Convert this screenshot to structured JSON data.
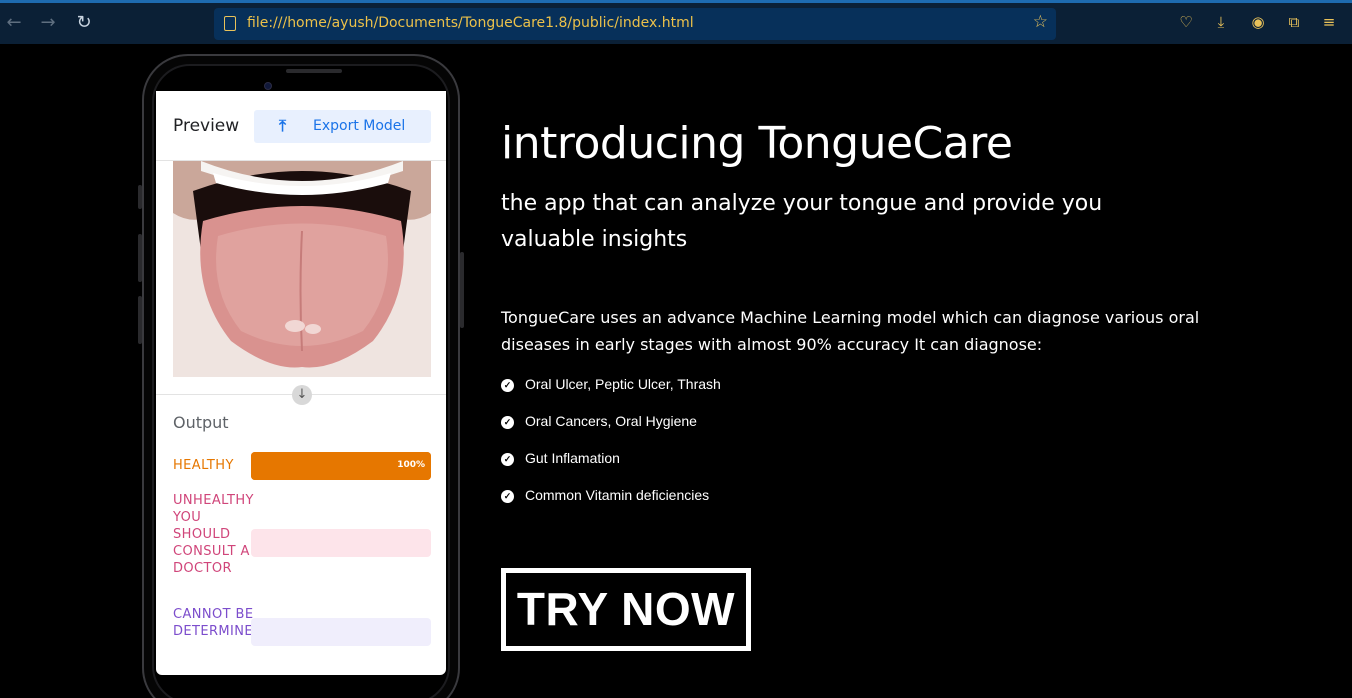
{
  "browser": {
    "url": "file:///home/ayush/Documents/TongueCare1.8/public/index.html",
    "icons": [
      "back-icon",
      "forward-icon",
      "reload-icon",
      "page-icon",
      "bookmark-star-icon",
      "pocket-icon",
      "download-icon",
      "account-icon",
      "extensions-icon",
      "menu-icon"
    ]
  },
  "preview": {
    "title": "Preview",
    "export_label": "Export Model"
  },
  "output": {
    "title": "Output",
    "classes": [
      {
        "label": "HEALTHY",
        "percent": 100,
        "percent_label": "100%",
        "color": "#e67700",
        "track": "#e67700"
      },
      {
        "label": "UNHEALTHY YOU SHOULD CONSULT A DOCTOR",
        "percent": 0,
        "percent_label": "",
        "color": "#d0457a",
        "track": "#fde4ea"
      },
      {
        "label": "CANNOT BE DETERMINED",
        "percent": 0,
        "percent_label": "",
        "color": "#7c4dcc",
        "track": "#f0eefc"
      }
    ]
  },
  "hero": {
    "title": "introducing TongueCare",
    "subtitle": "the app that can analyze your tongue and provide you valuable insights",
    "description": "TongueCare uses an advance Machine Learning model which can diagnose various oral diseases in early stages with almost 90% accuracy It can diagnose:",
    "features": [
      "Oral Ulcer, Peptic Ulcer, Thrash",
      "Oral Cancers, Oral Hygiene",
      "Gut Inflamation",
      "Common Vitamin deficiencies"
    ],
    "cta": "TRY NOW"
  }
}
